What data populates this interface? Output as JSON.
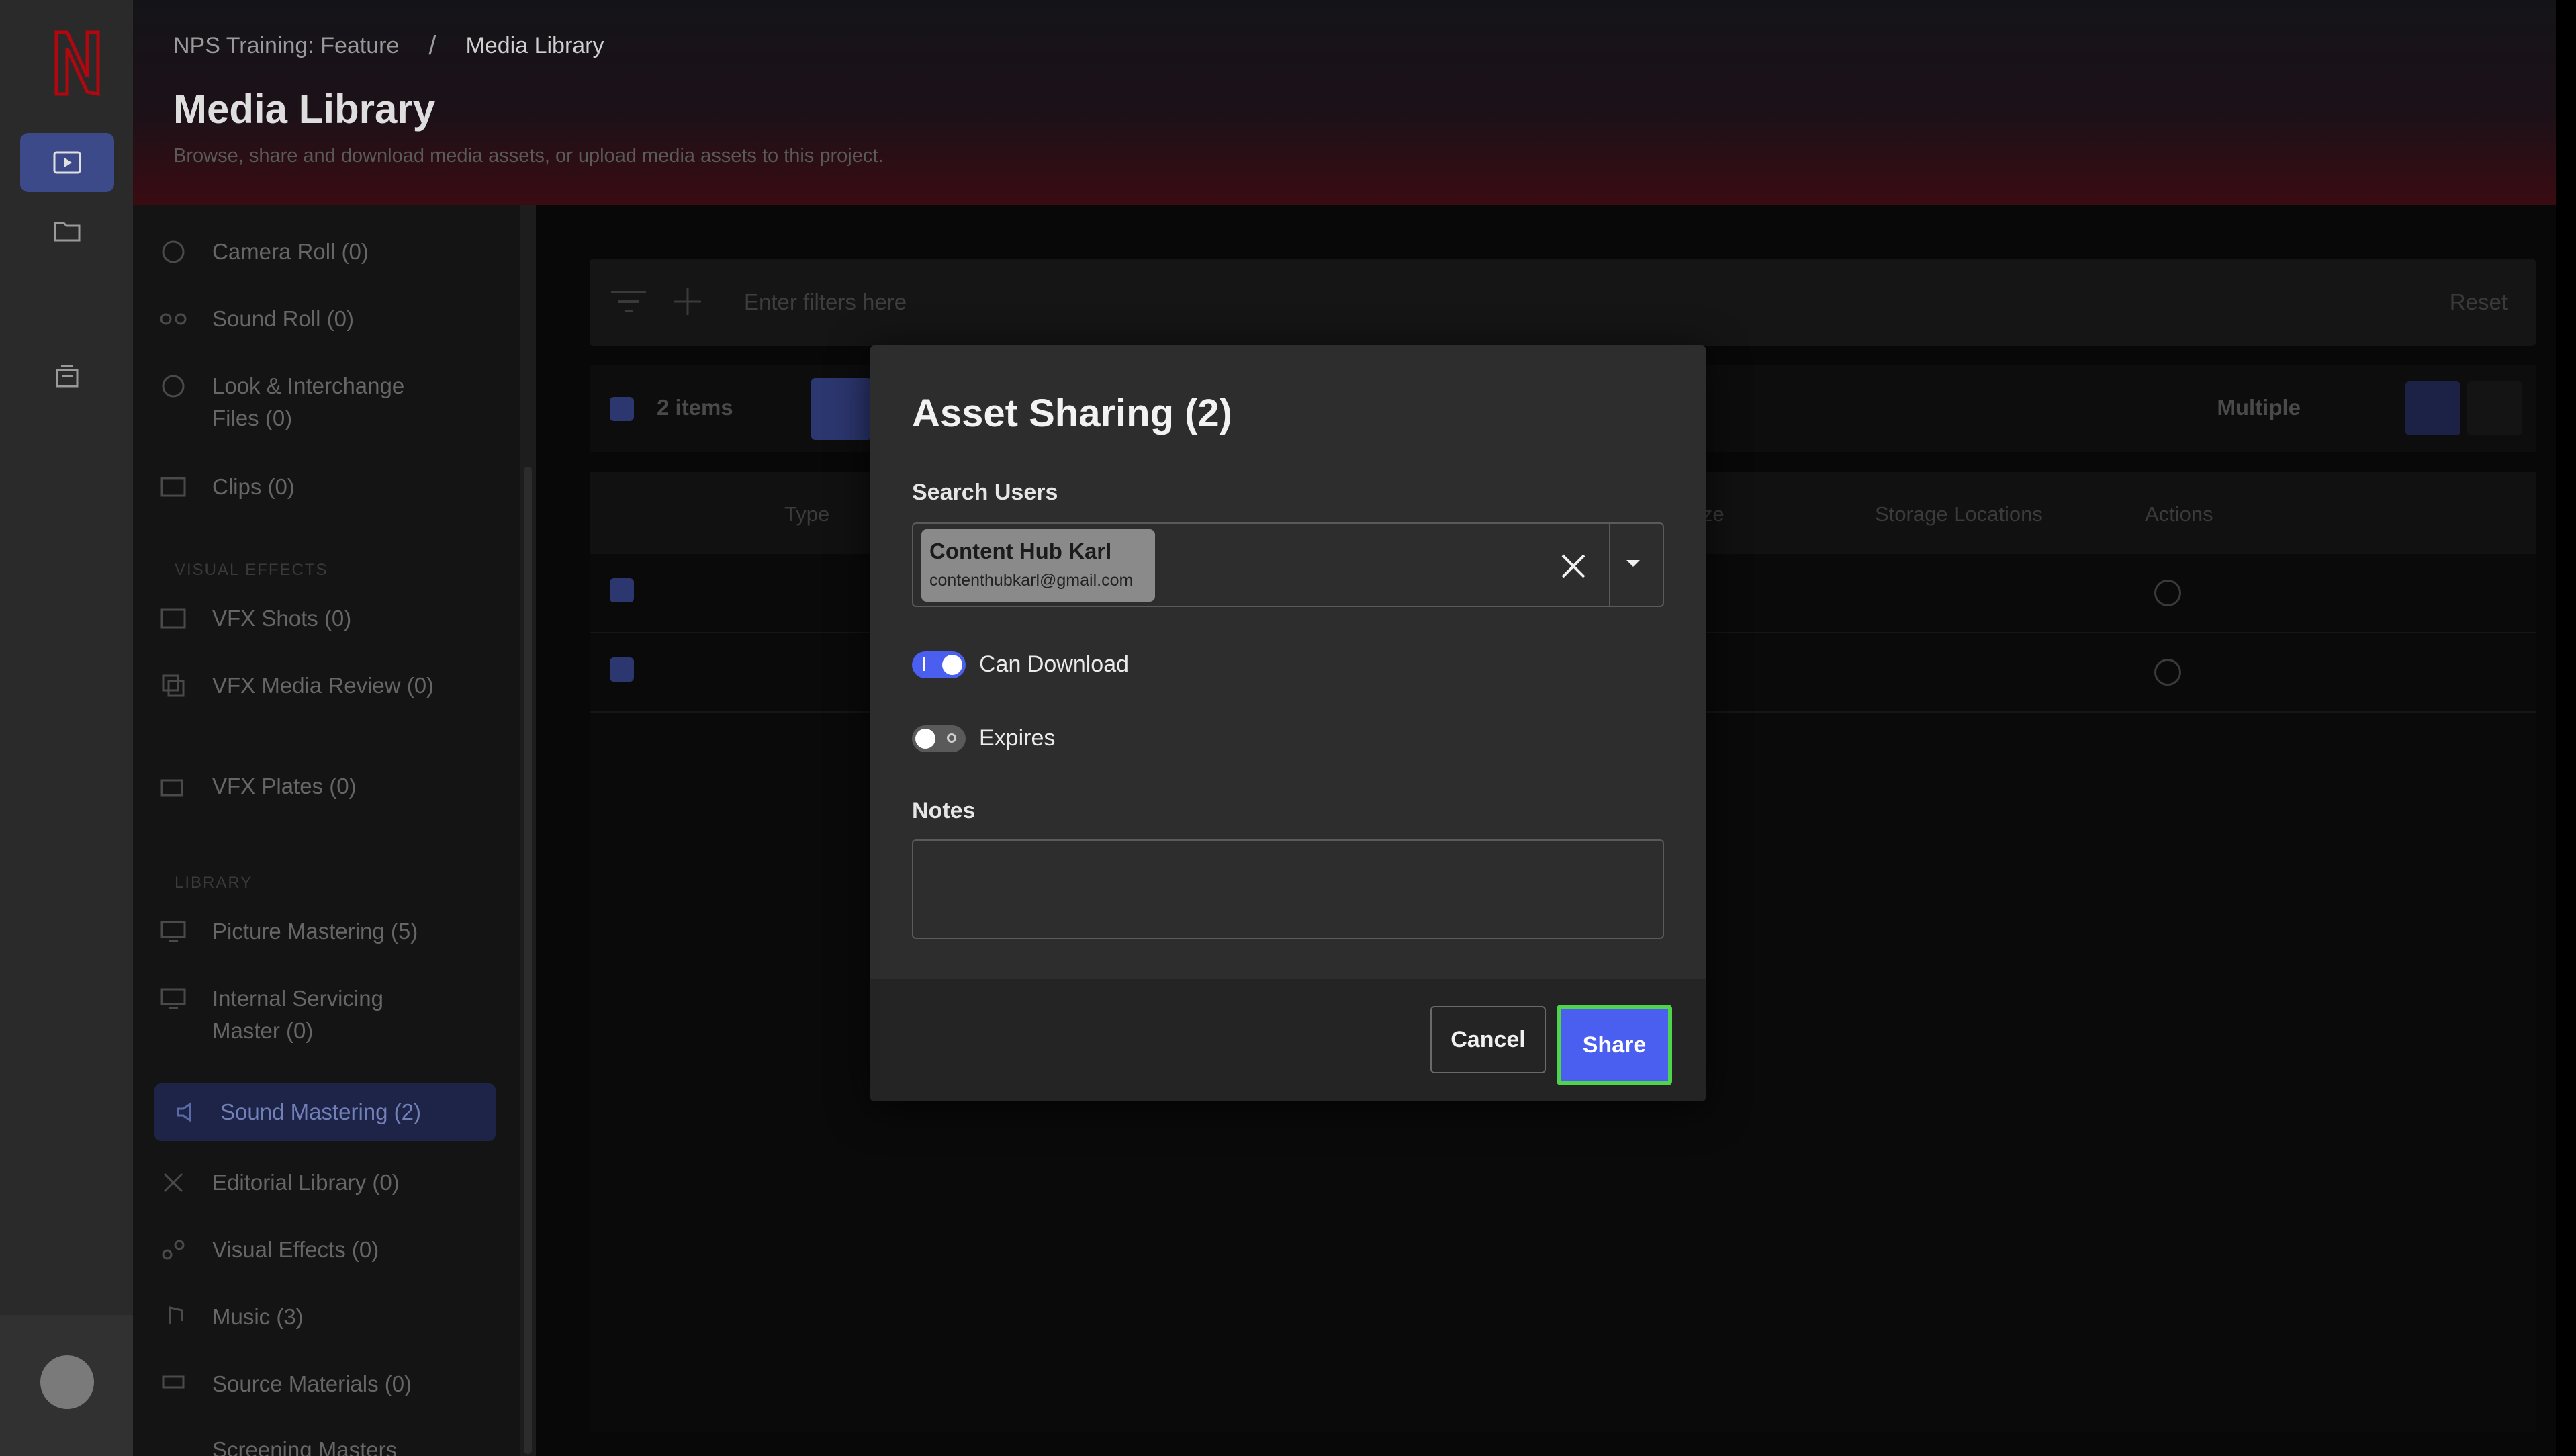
{
  "breadcrumb": [
    "NPS Training: Feature",
    "/",
    "Media Library"
  ],
  "header": {
    "title": "Media Library",
    "subtitle": "Browse, share and download media assets, or upload media assets to this project."
  },
  "sidebar": {
    "items": [
      {
        "label": "Camera Roll (0)"
      },
      {
        "label": "Sound Roll (0)"
      },
      {
        "label": "Look & Interchange Files (0)"
      },
      {
        "label": "Clips (0)"
      },
      {
        "label": "VFX Shots (0)"
      },
      {
        "label": "VFX Media Review (0)"
      },
      {
        "label": "VFX Plates (0)"
      },
      {
        "label": "Picture Mastering (5)"
      },
      {
        "label": "Internal Servicing Master (0)"
      },
      {
        "label": "Sound Mastering (2)"
      },
      {
        "label": "Editorial Library (0)"
      },
      {
        "label": "Visual Effects (0)"
      },
      {
        "label": "Music (3)"
      },
      {
        "label": "Source Materials (0)"
      },
      {
        "label": "Screening Masters"
      }
    ],
    "groups": [
      "VISUAL EFFECTS",
      "LIBRARY"
    ]
  },
  "main": {
    "filter_placeholder": "Enter filters here",
    "reset_label": "Reset",
    "selected_count": "2 items",
    "sort_label": "Multiple",
    "columns": [
      "Type",
      "ize",
      "Storage Locations",
      "Actions"
    ]
  },
  "modal": {
    "title": "Asset Sharing (2)",
    "search_label": "Search Users",
    "chip_name": "Content Hub Karl",
    "chip_email": "contenthubkarl@gmail.com",
    "can_download_label": "Can Download",
    "can_download_on": true,
    "expires_label": "Expires",
    "expires_on": false,
    "notes_label": "Notes",
    "notes_value": "",
    "cancel_label": "Cancel",
    "share_label": "Share"
  },
  "colors": {
    "accent": "#4a5ff0",
    "focus_ring": "#4fd44a",
    "brand": "#e50914"
  }
}
